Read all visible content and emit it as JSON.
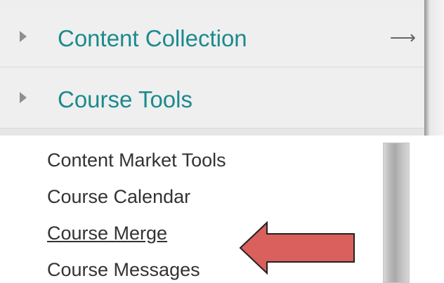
{
  "menu": {
    "items": [
      {
        "label": "Content Collection",
        "expand_icon": "triangle-right-icon",
        "action_icon": "arrow-right-icon",
        "action_glyph": "⟶"
      },
      {
        "label": "Course Tools",
        "expand_icon": "triangle-right-icon"
      }
    ]
  },
  "tools": {
    "items": [
      {
        "label": "Content Market Tools"
      },
      {
        "label": "Course Calendar"
      },
      {
        "label": "Course Merge",
        "highlighted": true
      },
      {
        "label": "Course Messages"
      }
    ]
  },
  "annotation": {
    "icon": "red-pointer-arrow-icon",
    "color": "#d9605c",
    "outline_color": "#222222"
  }
}
